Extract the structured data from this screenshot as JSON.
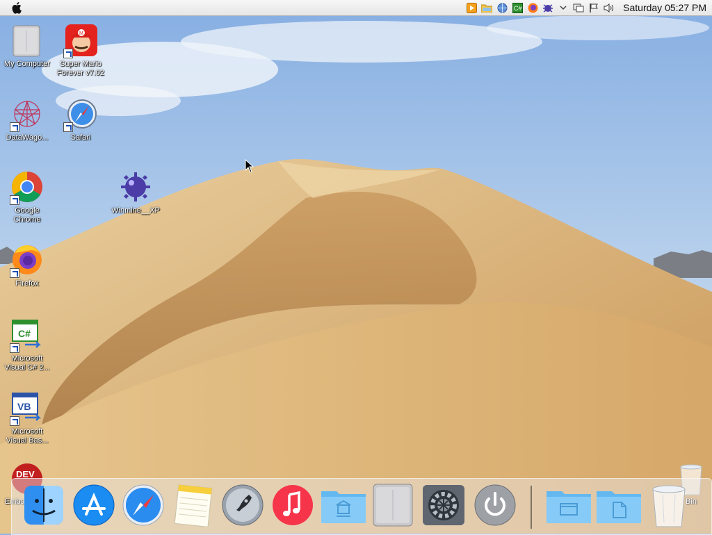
{
  "menubar": {
    "clock": "Saturday 05:27 PM",
    "tray_icons": [
      "media-player-icon",
      "folder-icon",
      "network-icon",
      "csharp-icon",
      "firefox-icon",
      "bug-icon",
      "chevron-down-icon",
      "monitor-icon",
      "flag-icon",
      "speaker-icon"
    ]
  },
  "desktop": {
    "icons": [
      {
        "label": "My Computer"
      },
      {
        "label": "Super Mario Forever v7.02"
      },
      {
        "label": "DataWago..."
      },
      {
        "label": "Safari"
      },
      {
        "label": "Google Chrome"
      },
      {
        "label": "Winmine__XP"
      },
      {
        "label": "Firefox"
      },
      {
        "label": "Microsoft Visual C# 2..."
      },
      {
        "label": "Microsoft Visual Bas..."
      },
      {
        "label": "Emba... De..."
      },
      {
        "label": "Bin"
      }
    ]
  },
  "dock": {
    "items": [
      "finder-icon",
      "app-store-icon",
      "safari-icon",
      "notes-icon",
      "launchpad-icon",
      "music-icon",
      "applications-folder-icon",
      "computer-icon",
      "system-preferences-icon",
      "shutdown-icon",
      "desktop-folder-icon",
      "documents-folder-icon",
      "trash-icon"
    ]
  },
  "colors": {
    "sky": "#8fb4e3",
    "sand": "#d9b27a",
    "menubar": "#ececec"
  }
}
